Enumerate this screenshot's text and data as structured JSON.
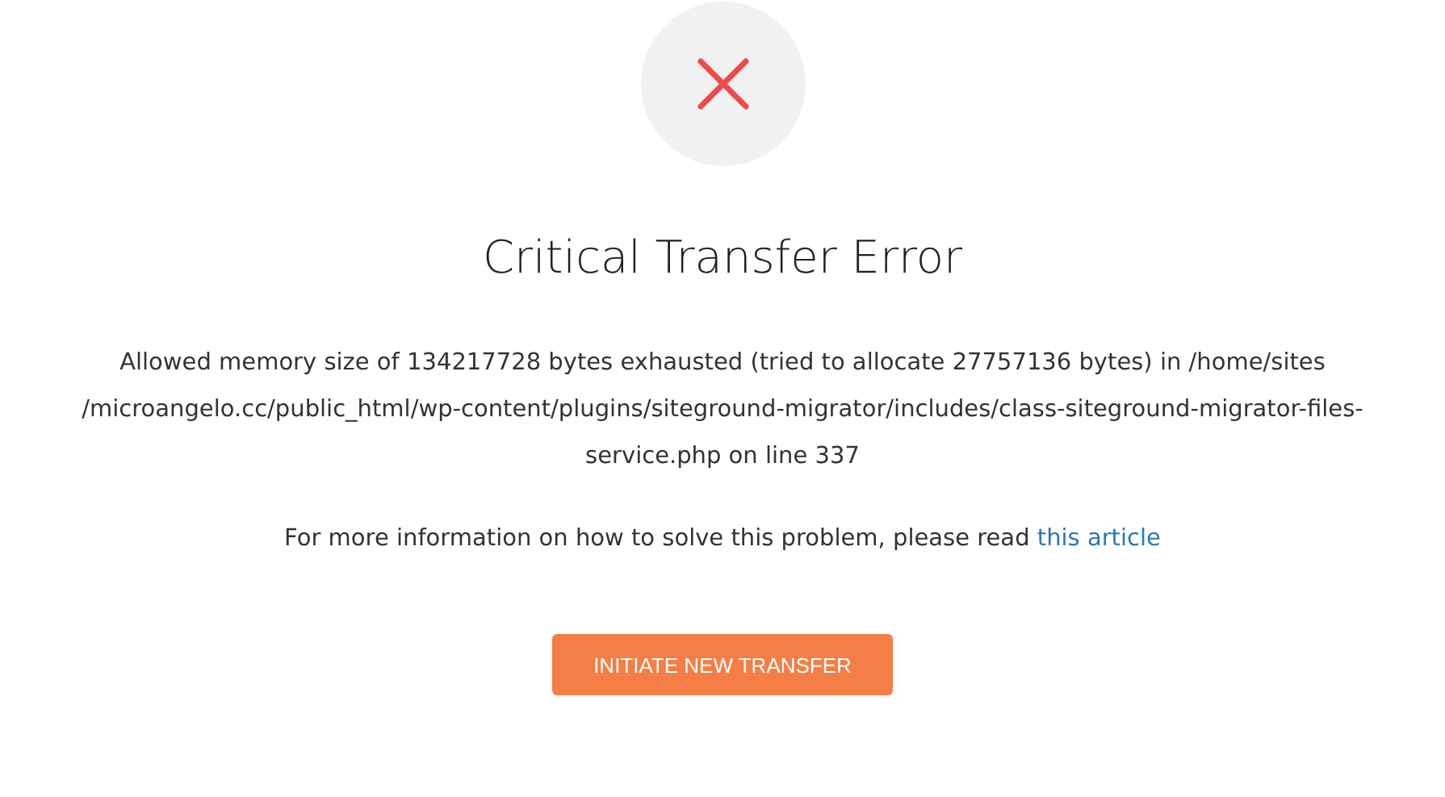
{
  "status_icon": {
    "kind": "error"
  },
  "title": "Critical Transfer Error",
  "message": "Allowed memory size of 134217728 bytes exhausted (tried to allocate 27757136 bytes) in /home/sites /microangelo.cc/public_html/wp-content/plugins/siteground-migrator/includes/class-siteground-migrator-files-service.php on line 337",
  "info": {
    "text": "For more information on how to solve this problem, please read ",
    "link": "this article"
  },
  "button": "INITIATE NEW TRANSFER"
}
